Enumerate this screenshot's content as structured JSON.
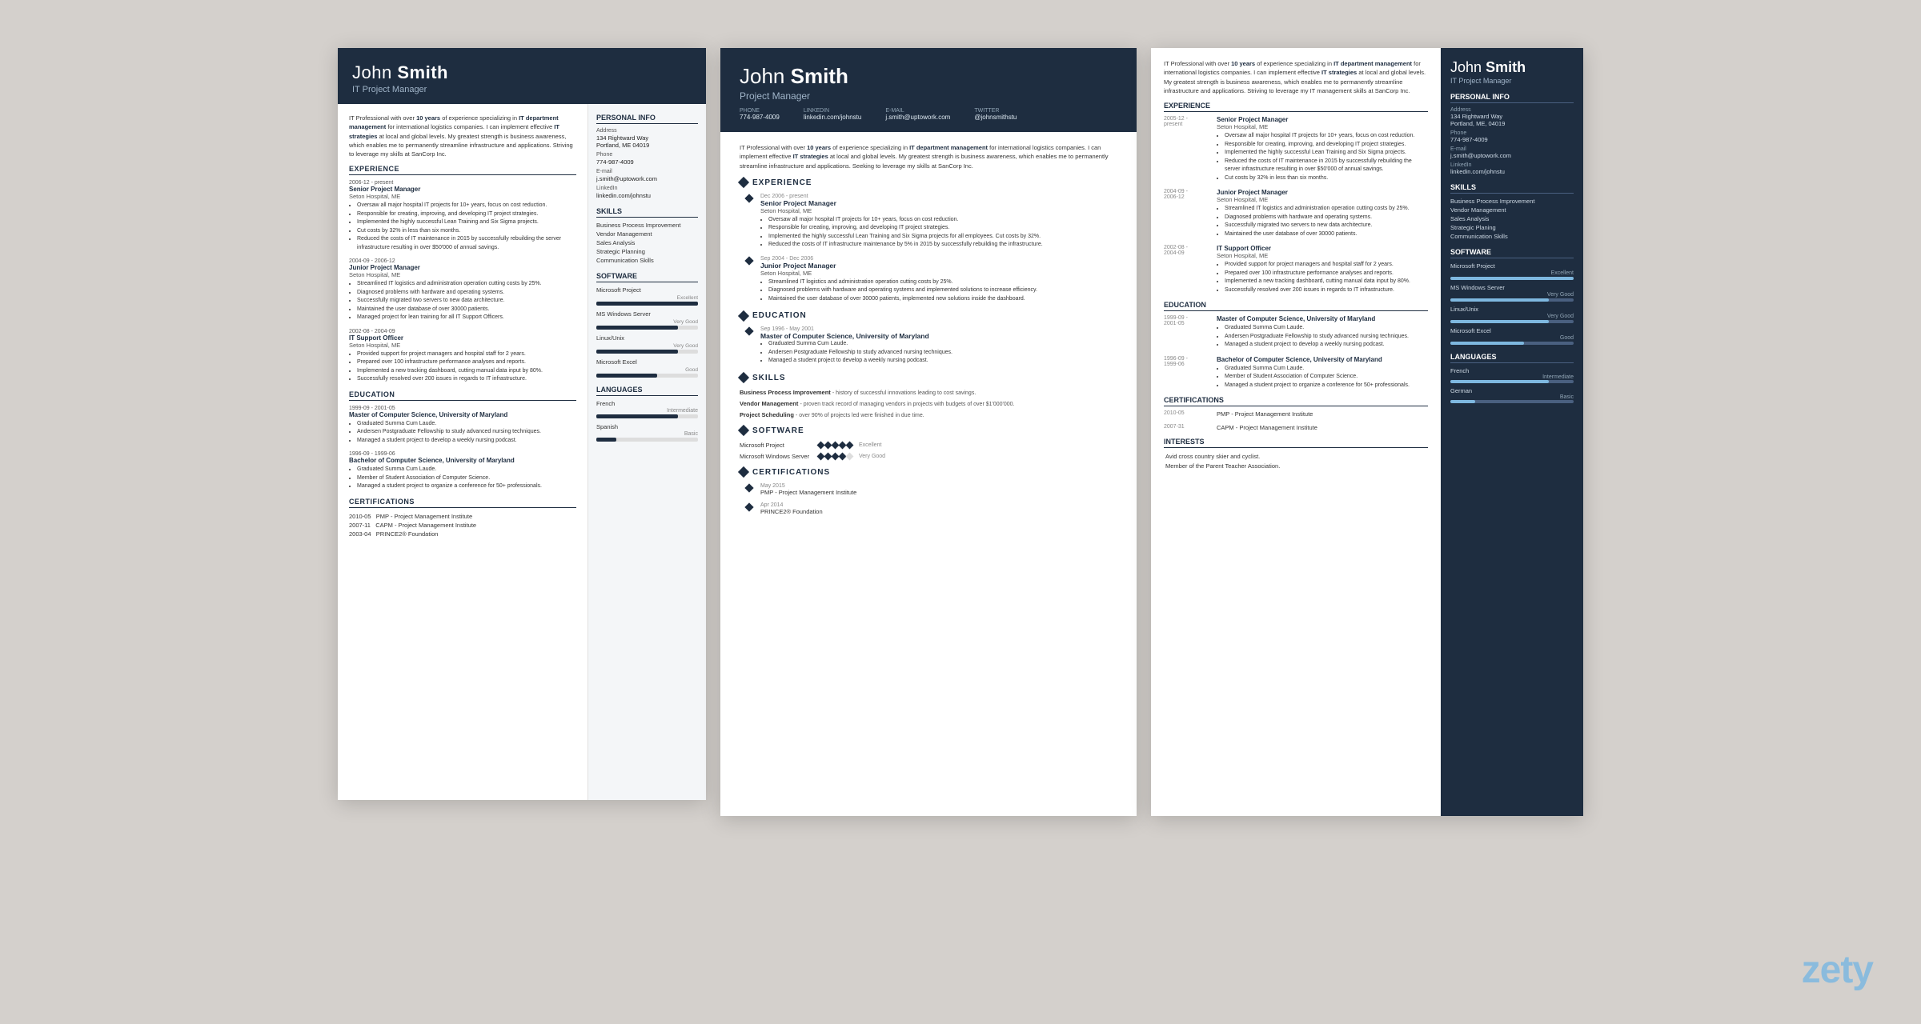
{
  "brand": "zety",
  "resume1": {
    "name_first": "John",
    "name_last": "Smith",
    "title": "IT Project Manager",
    "intro": "IT Professional with over 10 years of experience specializing in IT department management for international logistics companies. I can implement effective IT strategies at local and global levels. My greatest strength is business awareness, which enables me to permanently streamline infrastructure and applications. Striving to leverage my skills at SanCorp Inc.",
    "experience": [
      {
        "dates": "2006-12 - present",
        "job_title": "Senior Project Manager",
        "company": "Seton Hospital, ME",
        "bullets": [
          "Oversaw all major hospital IT projects for 10+ years, focus on cost reduction.",
          "Responsible for creating, improving, and developing IT project strategies.",
          "Implemented the highly successful Lean Training and Six Sigma projects.",
          "Cut costs by 32% in less than six months.",
          "Reduced the costs of IT maintenance in 2015 by successfully rebuilding the server infrastructure resulting in over $50'000 of annual savings."
        ]
      },
      {
        "dates": "2004-09 - 2006-12",
        "job_title": "Junior Project Manager",
        "company": "Seton Hospital, ME",
        "bullets": [
          "Streamlined IT logistics and administration operation cutting costs by 25%.",
          "Diagnosed problems with hardware and operating systems.",
          "Successfully migrated two servers to new data architecture.",
          "Maintained the user database of over 30000 patients.",
          "Managed project for lean training for all IT Support Officers."
        ]
      },
      {
        "dates": "2002-08 - 2004-09",
        "job_title": "IT Support Officer",
        "company": "Seton Hospital, ME",
        "bullets": [
          "Provided support for project managers and hospital staff for 2 years.",
          "Prepared over 100 infrastructure performance analyses and reports.",
          "Implemented a new tracking dashboard, cutting manual data input by 80%.",
          "Successfully resolved over 200 issues in regards to IT infrastructure."
        ]
      }
    ],
    "education": [
      {
        "dates": "1999-09 - 2001-05",
        "degree": "Master of Computer Science, University of Maryland",
        "bullets": [
          "Graduated Summa Cum Laude.",
          "Andersen Postgraduate Fellowship to study advanced nursing techniques.",
          "Managed a student project to develop a weekly nursing podcast."
        ]
      },
      {
        "dates": "1996-09 - 1999-06",
        "degree": "Bachelor of Computer Science, University of Maryland",
        "bullets": [
          "Graduated Summa Cum Laude.",
          "Member of Student Association of Computer Science.",
          "Managed a student project to organize a conference for 50+ professionals."
        ]
      }
    ],
    "certifications": [
      {
        "dates": "2010-05",
        "name": "PMP - Project Management Institute"
      },
      {
        "dates": "2007-11",
        "name": "CAPM - Project Management Institute"
      },
      {
        "dates": "2003-04",
        "name": "PRINCE2® Foundation"
      }
    ],
    "sidebar": {
      "personal_info_title": "Personal Info",
      "address_label": "Address",
      "address": "134 Rightward Way\nPortland, ME 04019",
      "phone_label": "Phone",
      "phone": "774-987-4009",
      "email_label": "E-mail",
      "email": "j.smith@uptowork.com",
      "linkedin_label": "LinkedIn",
      "linkedin": "linkedin.com/johnstu",
      "skills_title": "Skills",
      "skills": [
        "Business Process Improvement",
        "Vendor Management",
        "Sales Analysis",
        "Strategic Planning",
        "Communication Skills"
      ],
      "software_title": "Software",
      "software": [
        {
          "name": "Microsoft Project",
          "level": 100,
          "label": "Excellent"
        },
        {
          "name": "MS Windows Server",
          "level": 80,
          "label": "Very Good"
        },
        {
          "name": "Linux/Unix",
          "level": 80,
          "label": "Very Good"
        },
        {
          "name": "Microsoft Excel",
          "level": 60,
          "label": "Good"
        }
      ],
      "languages_title": "Languages",
      "languages": [
        {
          "name": "French",
          "level": 80,
          "label": "Intermediate"
        },
        {
          "name": "Spanish",
          "level": 20,
          "label": "Basic"
        }
      ]
    }
  },
  "resume2": {
    "name_first": "John",
    "name_last": "Smith",
    "title": "Project Manager",
    "contact": [
      {
        "label": "Phone",
        "value": "774-987-4009"
      },
      {
        "label": "LinkedIn",
        "value": "linkedin.com/johnstu"
      },
      {
        "label": "E-mail",
        "value": "j.smith@uptowork.com"
      },
      {
        "label": "Twitter",
        "value": "@johnsmithstu"
      }
    ],
    "intro": "IT Professional with over 10 years of experience specializing in IT department management for international logistics companies. I can implement effective IT strategies at local and global levels. My greatest strength is business awareness, which enables me to permanently streamline infrastructure and applications. Seeking to leverage my skills at SanCorp Inc.",
    "experience": [
      {
        "dates": "Dec 2006 - present",
        "job_title": "Senior Project Manager",
        "company": "Seton Hospital, ME",
        "bullets": [
          "Oversaw all major hospital IT projects for 10+ years, focus on cost reduction.",
          "Responsible for creating, improving, and developing IT project strategies.",
          "Implemented the highly successful Lean Training and Six Sigma projects for all employees. Cut costs by 32%.",
          "Reduced the costs of IT infrastructure maintenance by 5% in 2015 by successfully rebuilding the infrastructure."
        ]
      },
      {
        "dates": "Sep 2004 - Dec 2006",
        "job_title": "Junior Project Manager",
        "company": "Seton Hospital, ME",
        "bullets": [
          "Streamlined IT logistics and administration operation cutting costs by 25%.",
          "Diagnosed problems with hardware and operating systems and implemented solutions to increase efficiency.",
          "Maintained the user database of over 30000 patients, implemented new solutions inside the dashboard."
        ]
      }
    ],
    "education": [
      {
        "dates": "Sep 1996 - May 2001",
        "degree": "Master of Computer Science, University of Maryland",
        "bullets": [
          "Graduated Summa Cum Laude.",
          "Andersen Postgraduate Fellowship to study advanced nursing techniques.",
          "Managed a student project to develop a weekly nursing podcast."
        ]
      }
    ],
    "skills": [
      {
        "name": "Business Process Improvement",
        "desc": "- history of successful innovations leading to cost savings."
      },
      {
        "name": "Vendor Management",
        "desc": "- proven track record of managing vendors in projects with budgets of over $1'000'000."
      },
      {
        "name": "Project Scheduling",
        "desc": "- over 90% of projects led were finished in due time."
      }
    ],
    "software": [
      {
        "name": "Microsoft Project",
        "stars": 5,
        "label": "Excellent"
      },
      {
        "name": "Microsoft Windows Server",
        "stars": 4,
        "label": "Very Good"
      }
    ],
    "certifications": [
      {
        "dates": "May 2015",
        "name": "PMP - Project Management Institute"
      },
      {
        "dates": "Apr 2014",
        "name": "PRINCE2® Foundation"
      }
    ]
  },
  "resume3": {
    "name_first": "John",
    "name_last": "Smith",
    "title": "IT Project Manager",
    "intro": "IT Professional with over 10 years of experience specializing in IT department management for international logistics companies. I can implement effective IT strategies at local and global levels. My greatest strength is business awareness, which enables me to permanently streamline infrastructure and applications. Striving to leverage my IT management skills at SanCorp Inc.",
    "experience": [
      {
        "dates": "2005-12 - present",
        "job_title": "Senior Project Manager",
        "company": "Seton Hospital, ME",
        "bullets": [
          "Oversaw all major hospital IT projects for 10+ years, focus on cost reduction.",
          "Responsible for creating, improving, and developing IT project strategies.",
          "Implemented the highly successful Lean Training and Six Sigma projects.",
          "Reduced the costs of IT maintenance in 2015 by successfully rebuilding the server infrastructure resulting in over $50'000 of annual savings.",
          "Cut costs by 32% in less than six months."
        ]
      },
      {
        "dates": "2004-09 - 2006-12",
        "job_title": "Junior Project Manager",
        "company": "Seton Hospital, ME",
        "bullets": [
          "Streamlined IT logistics and administration operation cutting costs by 25%.",
          "Diagnosed problems with hardware and operating systems.",
          "Successfully migrated two servers to new data architecture.",
          "Maintained the user database of over 30000 patients."
        ]
      },
      {
        "dates": "2002-08 - 2004-09",
        "job_title": "IT Support Officer",
        "company": "Seton Hospital, ME",
        "bullets": [
          "Provided support for project managers and hospital staff for 2 years.",
          "Prepared over 100 infrastructure performance analyses and reports.",
          "Implemented a new tracking dashboard, cutting manual data input by 80%.",
          "Successfully resolved over 200 issues in regards to IT infrastructure."
        ]
      }
    ],
    "education": [
      {
        "dates": "1999-09 - 2001-05",
        "degree": "Master of Computer Science, University of Maryland",
        "bullets": [
          "Graduated Summa Cum Laude.",
          "Andersen Postgraduate Fellowship to study advanced nursing techniques.",
          "Managed a student project to develop a weekly nursing podcast."
        ]
      },
      {
        "dates": "1996-09 - 1999-06",
        "degree": "Bachelor of Computer Science, University of Maryland",
        "bullets": [
          "Graduated Summa Cum Laude.",
          "Member of Student Association of Computer Science.",
          "Managed a student project to organize a conference for 50+ professionals."
        ]
      }
    ],
    "certifications": [
      {
        "dates": "2010-05",
        "name": "PMP - Project Management Institute"
      },
      {
        "dates": "2007-31",
        "name": "CAPM - Project Management Institute"
      }
    ],
    "interests": "Avid cross country skier and cyclist.\nMember of the Parent Teacher Association.",
    "sidebar": {
      "address": "134 Rightward Way\nPortland, ME, 04019",
      "phone": "774-987-4009",
      "email": "j.smith@uptowork.com",
      "linkedin": "linkedin.com/johnstu",
      "skills": [
        "Business Process Improvement",
        "Vendor Management",
        "Sales Analysis",
        "Strategic Planning",
        "Communication Skills"
      ],
      "software": [
        {
          "name": "Microsoft Project",
          "level": 100,
          "label": "Excellent"
        },
        {
          "name": "MS Windows Server",
          "level": 80,
          "label": "Very Good"
        },
        {
          "name": "Linux/Unix",
          "level": 80,
          "label": "Very Good"
        },
        {
          "name": "Microsoft Excel",
          "level": 60,
          "label": "Good"
        }
      ],
      "languages": [
        {
          "name": "French",
          "level": 80,
          "label": "Intermediate"
        },
        {
          "name": "German",
          "level": 20,
          "label": "Basic"
        }
      ]
    }
  }
}
